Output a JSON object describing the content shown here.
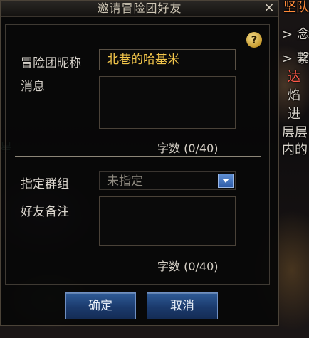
{
  "dialog": {
    "title": "邀请冒险团好友",
    "close_glyph": "×",
    "help_glyph": "?",
    "nickname_label": "冒险团昵称",
    "nickname_value": "北巷的哈基米",
    "message_label": "消息",
    "message_counter": "字数 (0/40)",
    "group_label": "指定群组",
    "group_value": "未指定",
    "remark_label": "好友备注",
    "remark_counter": "字数 (0/40)",
    "confirm_label": "确定",
    "cancel_label": "取消"
  },
  "background_chat": {
    "lines": [
      {
        "text": "坚队",
        "color": "#ff8a3a"
      },
      {
        "text": "> 念",
        "color": "#d9d4cc"
      },
      {
        "text": "> 繋",
        "color": "#d9d4cc"
      },
      {
        "text": "达",
        "color": "#ff5a4a"
      },
      {
        "text": "焰",
        "color": "#d9d4cc"
      },
      {
        "text": "进",
        "color": "#d9d4cc"
      },
      {
        "text": "层层",
        "color": "#d9d4cc"
      },
      {
        "text": "内的",
        "color": "#d9d4cc"
      }
    ],
    "left_fragment": "星"
  }
}
